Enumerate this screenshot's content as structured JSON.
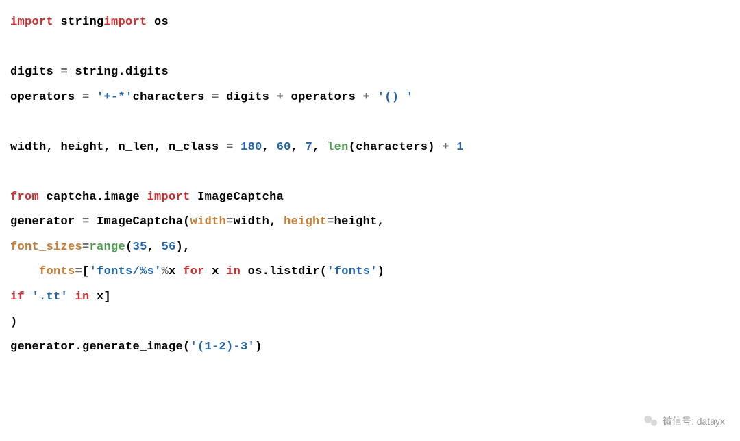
{
  "code": {
    "l1_import1": "import",
    "l1_id1": " string",
    "l1_import2": "import",
    "l1_id2": " os",
    "l3_id1": "digits ",
    "l3_op": "=",
    "l3_id2": " string.digits",
    "l4_id1": "operators ",
    "l4_op1": "=",
    "l4_str1": " '+-*'",
    "l4_id2": "characters ",
    "l4_op2": "=",
    "l4_id3": " digits ",
    "l4_op3": "+",
    "l4_id4": " operators ",
    "l4_op4": "+",
    "l4_str2": " '() '",
    "l6_id1": "width, height, n_len, n_class ",
    "l6_op1": "=",
    "l6_num1": " 180",
    "l6_id2": ", ",
    "l6_num2": "60",
    "l6_id3": ", ",
    "l6_num3": "7",
    "l6_id4": ", ",
    "l6_fn": "len",
    "l6_id5": "(characters) ",
    "l6_op2": "+",
    "l6_num4": " 1",
    "l8_from": "from",
    "l8_mod": " captcha.image ",
    "l8_import": "import",
    "l8_cls": " ImageCaptcha",
    "l9_id1": "generator ",
    "l9_op": "=",
    "l9_fn": " ImageCaptcha(",
    "l9_p1": "width",
    "l9_op2": "=",
    "l9_id2": "width, ",
    "l9_p2": "height",
    "l9_op3": "=",
    "l9_id3": "height,",
    "l10_p1": "font_sizes",
    "l10_op": "=",
    "l10_fn": "range",
    "l10_id1": "(",
    "l10_num1": "35",
    "l10_id2": ", ",
    "l10_num2": "56",
    "l10_id3": "),",
    "l11_indent": "    ",
    "l11_p1": "fonts",
    "l11_op1": "=",
    "l11_id1": "[",
    "l11_str1": "'fonts/%s'",
    "l11_op2": "%",
    "l11_id2": "x ",
    "l11_kw": "for",
    "l11_id3": " x ",
    "l11_kw2": "in",
    "l11_id4": " os.listdir(",
    "l11_str2": "'fonts'",
    "l11_id5": ")",
    "l12_kw": "if",
    "l12_str": " '.tt'",
    "l12_kw2": " in",
    "l12_id": " x]",
    "l13_id": ")",
    "l14_id1": "generator.generate_image(",
    "l14_str": "'(1-2)-3'",
    "l14_id2": ")"
  },
  "watermark": {
    "label": "微信号: datayx"
  }
}
